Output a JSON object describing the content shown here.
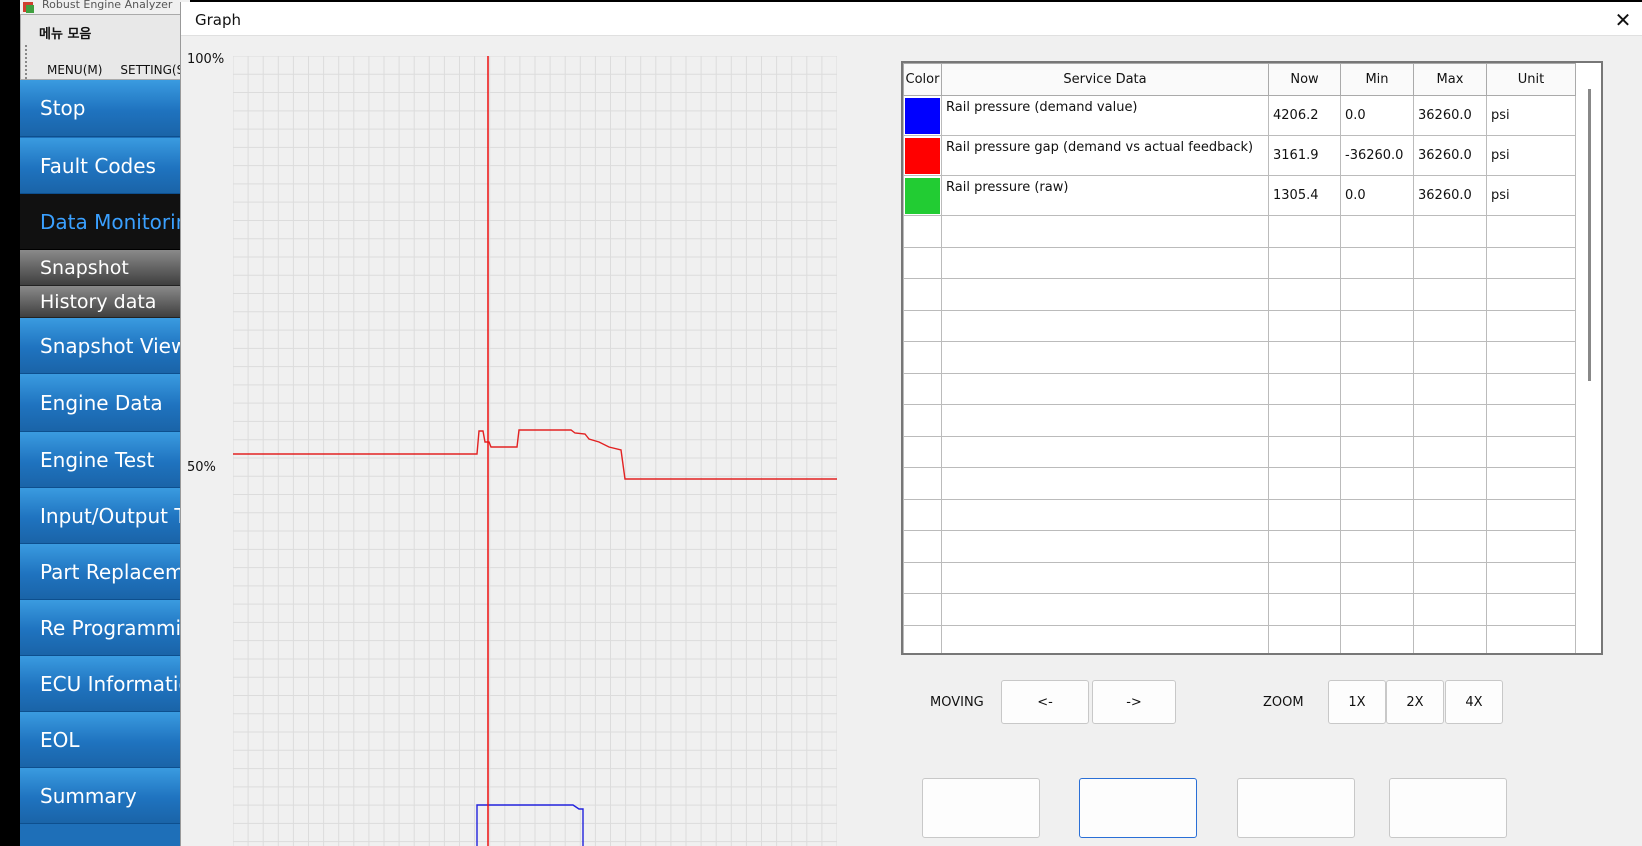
{
  "back_window": {
    "title": "Robust Engine Analyzer",
    "menu_panel_title": "메뉴 모음",
    "menubar": [
      "MENU(M)",
      "SETTING(S)"
    ],
    "sidebar": [
      {
        "label": "Stop",
        "state": "normal"
      },
      {
        "label": "Fault Codes",
        "state": "normal"
      },
      {
        "label": "Data Monitoring",
        "state": "active"
      },
      {
        "label": "Snapshot",
        "state": "grey"
      },
      {
        "label": "History data",
        "state": "grey"
      },
      {
        "label": "Snapshot Viewer",
        "state": "normal"
      },
      {
        "label": "Engine Data",
        "state": "normal"
      },
      {
        "label": "Engine Test",
        "state": "normal"
      },
      {
        "label": "Input/Output Test",
        "state": "normal"
      },
      {
        "label": "Part Replacement",
        "state": "normal"
      },
      {
        "label": "Re Programming",
        "state": "normal"
      },
      {
        "label": "ECU Information",
        "state": "normal"
      },
      {
        "label": "EOL",
        "state": "normal"
      },
      {
        "label": "Summary",
        "state": "normal"
      }
    ]
  },
  "graph_window": {
    "title": "Graph",
    "close_icon": "close-icon",
    "y_labels": {
      "top": "100%",
      "mid": "50%"
    },
    "table": {
      "headers": {
        "color": "Color",
        "name": "Service Data",
        "now": "Now",
        "min": "Min",
        "max": "Max",
        "unit": "Unit"
      },
      "rows": [
        {
          "color": "#0000ff",
          "name": "Rail pressure (demand value)",
          "now": "4206.2",
          "min": "0.0",
          "max": "36260.0",
          "unit": "psi"
        },
        {
          "color": "#ff0000",
          "name": "Rail pressure gap (demand vs actual feedback)",
          "now": "3161.9",
          "min": "-36260.0",
          "max": "36260.0",
          "unit": "psi"
        },
        {
          "color": "#22cc33",
          "name": "Rail pressure (raw)",
          "now": "1305.4",
          "min": "0.0",
          "max": "36260.0",
          "unit": "psi"
        }
      ]
    },
    "controls": {
      "moving_label": "MOVING",
      "left_label": "<-",
      "right_label": "->",
      "zoom_label": "ZOOM",
      "zoom_1x": "1X",
      "zoom_2x": "2X",
      "zoom_4x": "4X"
    }
  }
}
